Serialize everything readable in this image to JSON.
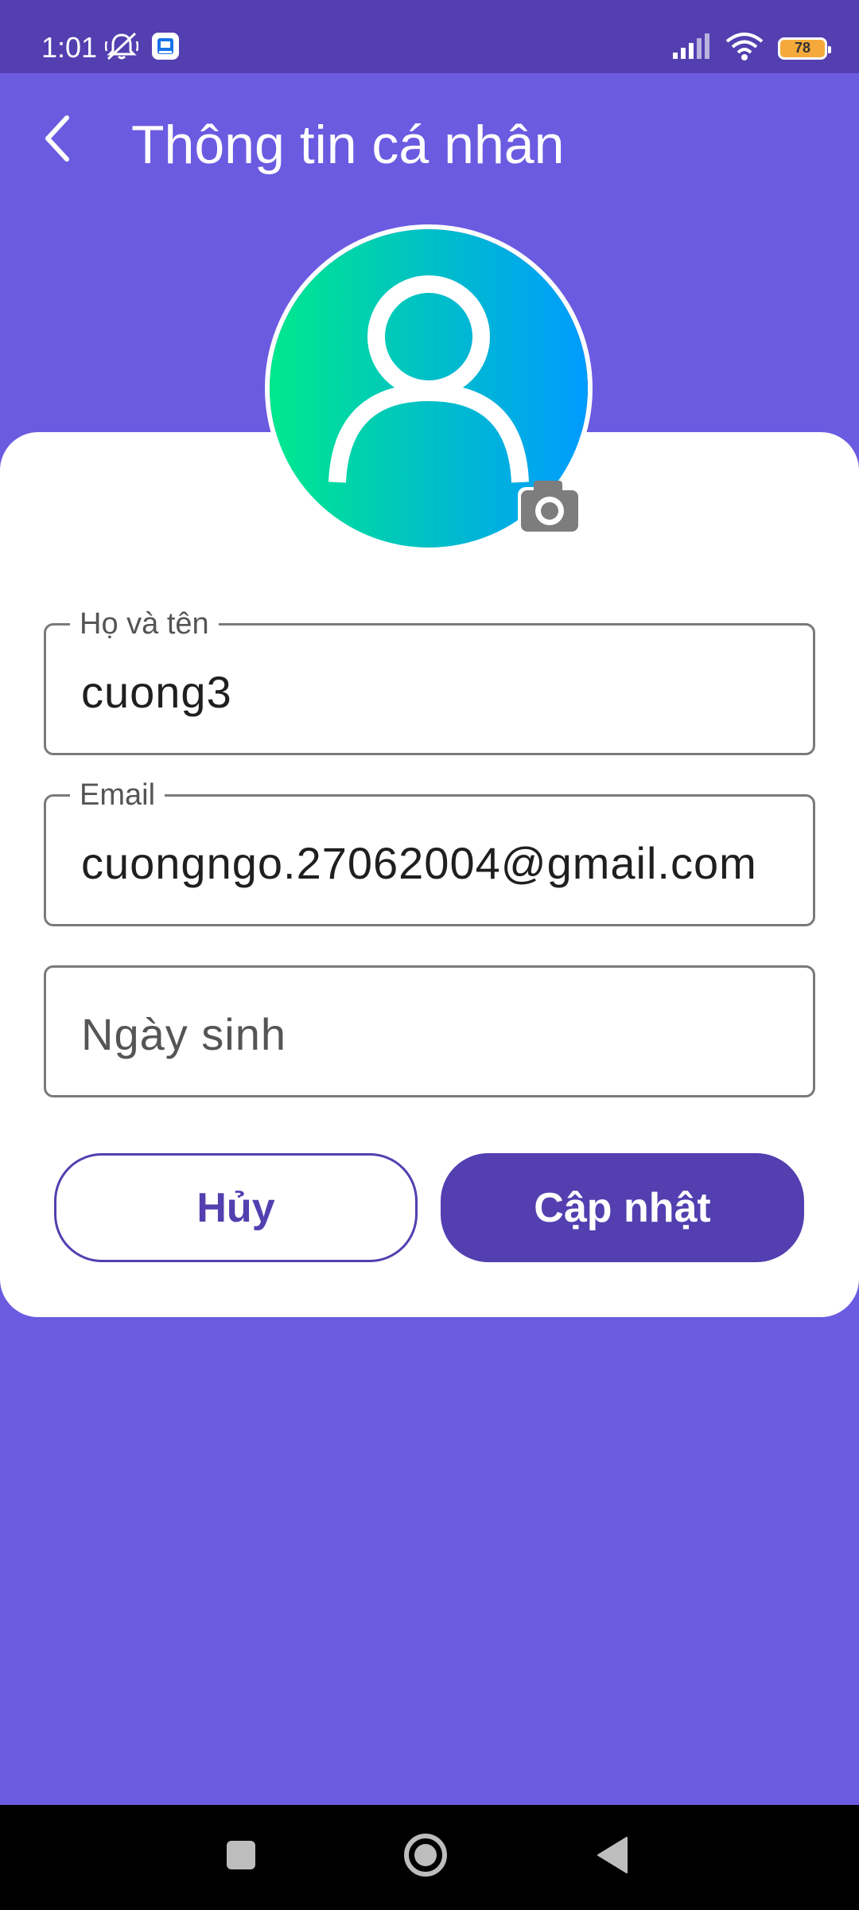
{
  "status_bar": {
    "time": "1:01",
    "battery_level": "78",
    "icons_left": [
      "mute-alarm-icon",
      "app-notification-icon"
    ],
    "icons_right": [
      "signal-icon",
      "wifi-icon",
      "battery-icon"
    ]
  },
  "app_bar": {
    "title": "Thông tin cá nhân",
    "back_icon": "chevron-left-icon"
  },
  "avatar": {
    "icon": "user-icon",
    "camera_icon": "camera-icon",
    "gradient": [
      "#00e98c",
      "#009bff"
    ]
  },
  "form": {
    "fields": [
      {
        "label": "Họ và tên",
        "value": "cuong3"
      },
      {
        "label": "Email",
        "value": "cuongngo.27062004@gmail.com"
      },
      {
        "label": "",
        "placeholder": "Ngày sinh"
      }
    ]
  },
  "buttons": {
    "cancel_label": "Hủy",
    "update_label": "Cập nhật"
  },
  "colors": {
    "background": "#6b5be1",
    "status_bar": "#533fb0",
    "primary": "#533fb0",
    "card": "#ffffff"
  },
  "nav_bar": {
    "items": [
      "recents-icon",
      "home-icon",
      "back-icon"
    ]
  }
}
